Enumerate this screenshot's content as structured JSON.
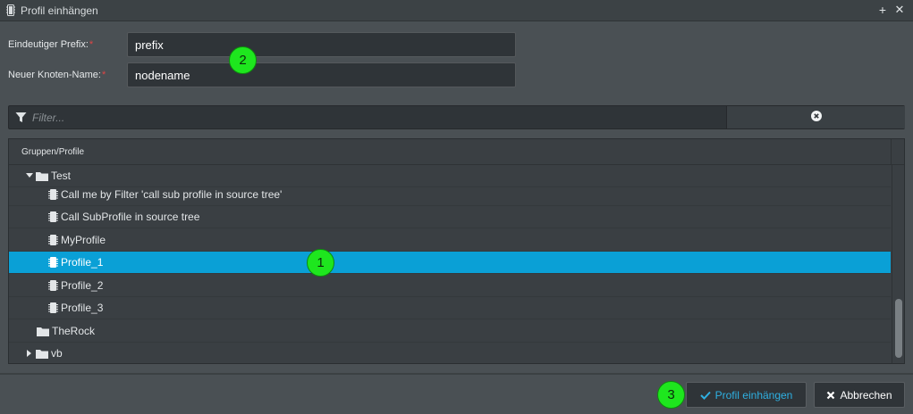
{
  "window": {
    "title": "Profil einhängen",
    "plus_symbol": "+",
    "close_symbol": "✕"
  },
  "form": {
    "prefix_label": "Eindeutiger Prefix:",
    "prefix_value": "prefix",
    "node_label": "Neuer Knoten-Name:",
    "node_value": "nodename",
    "required_mark": "*"
  },
  "filter": {
    "placeholder": "Filter..."
  },
  "tree": {
    "header": "Gruppen/Profile",
    "rows": [
      {
        "label": "Test",
        "type": "folder",
        "expanded": true
      },
      {
        "label": "Call me by Filter 'call sub profile in source tree'",
        "type": "profile"
      },
      {
        "label": "Call SubProfile in source tree",
        "type": "profile"
      },
      {
        "label": "MyProfile",
        "type": "profile"
      },
      {
        "label": "Profile_1",
        "type": "profile",
        "selected": true
      },
      {
        "label": "Profile_2",
        "type": "profile"
      },
      {
        "label": "Profile_3",
        "type": "profile"
      },
      {
        "label": "TheRock",
        "type": "folder"
      },
      {
        "label": "vb",
        "type": "folder",
        "expanded": false
      }
    ]
  },
  "buttons": {
    "ok_label": "Profil einhängen",
    "cancel_label": "Abbrechen"
  },
  "markers": [
    "1",
    "2",
    "3"
  ],
  "colors": {
    "selection": "#0aa0d6",
    "accent": "#2fb0e2",
    "required": "#e04545",
    "marker": "#1ee61e"
  }
}
